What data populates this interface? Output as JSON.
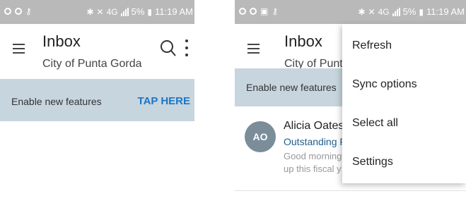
{
  "left_screen": {
    "status": {
      "left_icons": [
        "wifi-icon",
        "sync-icon",
        "key-icon"
      ],
      "right_text": "5%",
      "time": "11:19 AM",
      "network": "4G"
    },
    "header": {
      "title": "Inbox",
      "subtitle": "City of Punta Gorda"
    },
    "banner": {
      "text": "Enable new features",
      "action": "TAP HERE"
    }
  },
  "right_screen": {
    "status": {
      "left_icons": [
        "wifi-icon",
        "sync-icon",
        "image-icon",
        "key-icon"
      ],
      "right_text": "5%",
      "time": "11:19 AM",
      "network": "4G"
    },
    "header": {
      "title": "Inbox",
      "subtitle": "City of Punta"
    },
    "banner": {
      "text": "Enable new features"
    },
    "email": {
      "avatar_initials": "AO",
      "sender": "Alicia Oates",
      "subject": "Outstanding P",
      "preview_line1": "Good morning",
      "preview_line2": "up this fiscal y"
    },
    "menu": {
      "items": [
        "Refresh",
        "Sync options",
        "Select all",
        "Settings"
      ]
    }
  },
  "colors": {
    "accent": "#1a76c7",
    "banner_bg": "#c7d5de",
    "statusbar_bg": "#b9b9b9",
    "avatar_bg": "#7a8d99"
  }
}
